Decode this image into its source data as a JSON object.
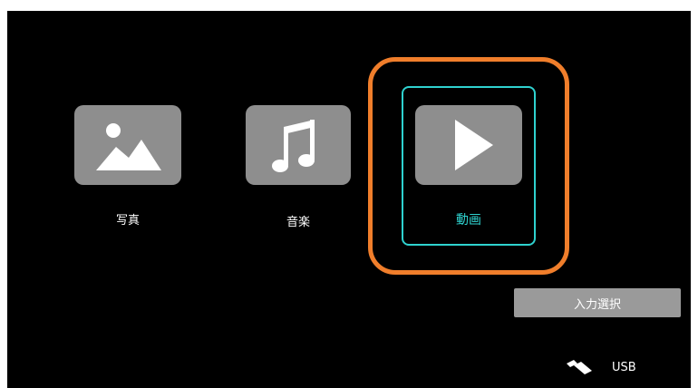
{
  "menu": {
    "items": [
      {
        "label": "写真",
        "icon": "photo-icon"
      },
      {
        "label": "音楽",
        "icon": "music-note-icon"
      },
      {
        "label": "動画",
        "icon": "play-icon"
      }
    ],
    "selected_index": 2
  },
  "input_select": {
    "label": "入力選択"
  },
  "source": {
    "label": "USB",
    "icon": "usb-drive-icon"
  },
  "colors": {
    "background": "#000000",
    "tile": "#8e8e8e",
    "selected_text": "#2fd2cf",
    "selected_frame": "#2fd2cf",
    "focus_ring": "#f07e2b"
  }
}
